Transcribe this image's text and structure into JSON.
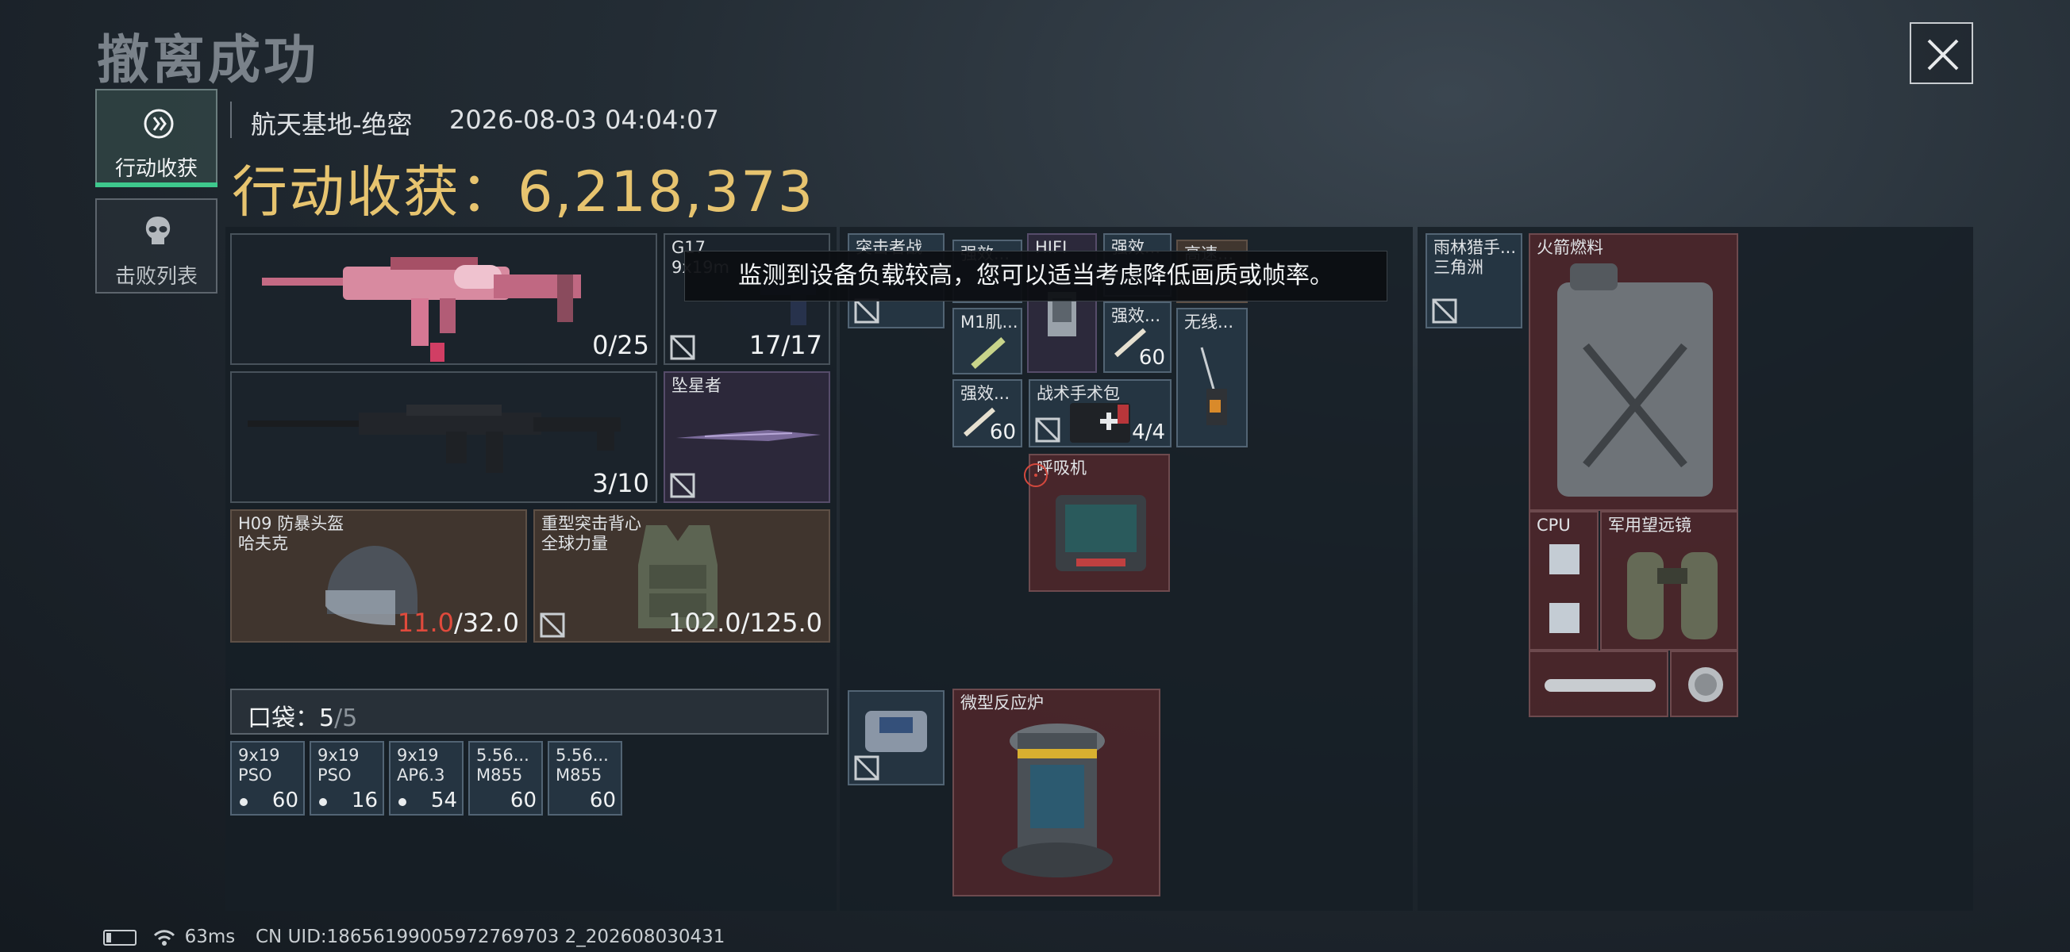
{
  "header": {
    "title": "撤离成功",
    "map_name": "航天基地-绝密",
    "timestamp": "2026-08-03 04:04:07",
    "haul_label": "行动收获：",
    "haul_value": "6,218,373"
  },
  "tabs": [
    {
      "label": "行动收获",
      "icon": "loot-icon",
      "active": true
    },
    {
      "label": "击败列表",
      "icon": "skull-icon",
      "active": false
    }
  ],
  "gear": {
    "primary_weapon": {
      "ammo": "0/25"
    },
    "sidearm": {
      "name_line1": "G17",
      "name_line2": "9x19m",
      "ammo": "17/17"
    },
    "secondary_weapon": {
      "ammo": "3/10"
    },
    "melee": {
      "name": "坠星者"
    },
    "helmet": {
      "name_line1": "H09 防暴头盔",
      "name_line2": "哈夫克",
      "durability_current": "11.0",
      "durability_max": "/32.0"
    },
    "armor": {
      "name_line1": "重型突击背心",
      "name_line2": "全球力量",
      "durability": "102.0/125.0"
    }
  },
  "pocket": {
    "label": "口袋：",
    "used": "5",
    "total": "/5",
    "items": [
      {
        "line1": "9x19",
        "line2": "PSO",
        "count": "60"
      },
      {
        "line1": "9x19",
        "line2": "PSO",
        "count": "16"
      },
      {
        "line1": "9x19",
        "line2": "AP6.3",
        "count": "54"
      },
      {
        "line1": "5.56...",
        "line2": "M855",
        "count": "60"
      },
      {
        "line1": "5.56...",
        "line2": "M855",
        "count": "60"
      }
    ]
  },
  "backpack": {
    "items": {
      "assault_rig": "突击者战",
      "stim_a": "强效...",
      "hifi": "HIFI",
      "stim_b": "强效...",
      "fast": "高速...",
      "stim_b_count": "60",
      "m1": "M1肌...",
      "stim_c": "强效...",
      "stim_c_count": "60",
      "wireless": "无线...",
      "stim_d": "强效...",
      "stim_d_count": "60",
      "surgical_kit": "战术手术包",
      "surgical_kit_count": "4/4",
      "ventilator": "呼吸机",
      "reactor": "微型反应炉"
    }
  },
  "safe_box": {
    "items": {
      "rainforest": "雨林猎手...",
      "rainforest_sub": "三角洲",
      "rocket_fuel": "火箭燃料",
      "cpu": "CPU",
      "binoculars": "军用望远镜"
    }
  },
  "toast": "监测到设备负载较高，您可以适当考虑降低画质或帧率。",
  "status": {
    "ping": "63ms",
    "uid": "CN UID:18656199005972769703 2_202608030431"
  },
  "colors": {
    "accent_gold": "#e7c46f",
    "active_tab_bar": "#3ec88d",
    "durability_low": "#e04a3c"
  }
}
